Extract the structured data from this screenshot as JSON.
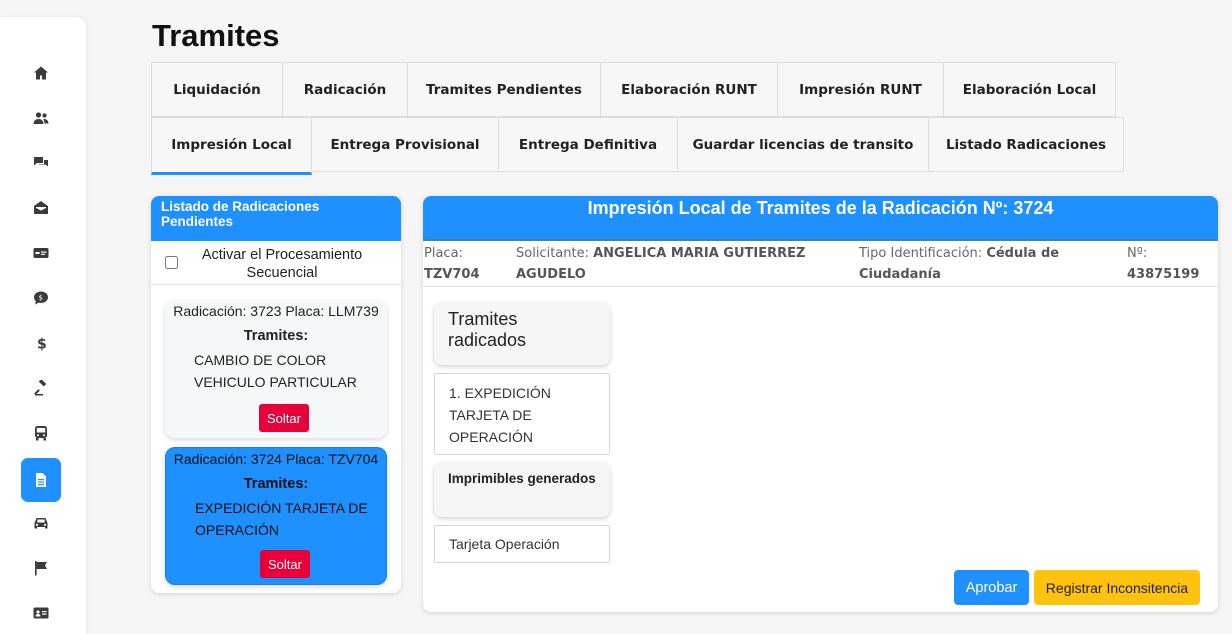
{
  "sidebar": {
    "items": [
      {
        "icon": "home-icon"
      },
      {
        "icon": "users-icon"
      },
      {
        "icon": "comments-icon"
      },
      {
        "icon": "mail-open-icon"
      },
      {
        "icon": "money-card-icon"
      },
      {
        "icon": "comment-dollar-icon"
      },
      {
        "icon": "dollar-icon"
      },
      {
        "icon": "gavel-icon"
      },
      {
        "icon": "bus-icon"
      },
      {
        "icon": "document-icon",
        "active": true
      },
      {
        "icon": "car-icon"
      },
      {
        "icon": "flag-icon"
      },
      {
        "icon": "id-card-icon"
      }
    ],
    "accent_color": "#1e90ff"
  },
  "page": {
    "title": "Tramites"
  },
  "tabs": [
    {
      "label": "Liquidación"
    },
    {
      "label": "Radicación"
    },
    {
      "label": "Tramites Pendientes"
    },
    {
      "label": "Elaboración RUNT"
    },
    {
      "label": "Impresión RUNT"
    },
    {
      "label": "Elaboración Local"
    },
    {
      "label": "Impresión Local",
      "active": true
    },
    {
      "label": "Entrega Provisional"
    },
    {
      "label": "Entrega Definitiva"
    },
    {
      "label": "Guardar licencias de transito"
    },
    {
      "label": "Listado Radicaciones"
    }
  ],
  "left_panel": {
    "title": "Listado de Radicaciones Pendientes",
    "sequential_label": "Activar el Procesamiento Secuencial",
    "sequential_checked": false,
    "cards": [
      {
        "header": "Radicación: 3723 Placa: LLM739",
        "tramites_label": "Tramites:",
        "tramites": "CAMBIO DE COLOR VEHICULO PARTICULAR",
        "button": "Soltar",
        "selected": false
      },
      {
        "header": "Radicación: 3724 Placa: TZV704",
        "tramites_label": "Tramites:",
        "tramites": "EXPEDICIÓN TARJETA DE OPERACIÓN",
        "button": "Soltar",
        "selected": true
      }
    ]
  },
  "right_panel": {
    "title": "Impresión Local de Tramites de la Radicación Nº: 3724",
    "info": {
      "placa_label": "Placa:",
      "placa_value": "TZV704",
      "solicitante_label": "Solicitante:",
      "solicitante_value": "ANGELICA MARIA GUTIERREZ AGUDELO",
      "tipo_id_label": "Tipo Identificación:",
      "tipo_id_value": "Cédula de Ciudadanía",
      "numero_label": "Nº:",
      "numero_value": "43875199"
    },
    "tramites_radicados_title": "Tramites radicados",
    "tramites_radicados": [
      "1. EXPEDICIÓN TARJETA DE OPERACIÓN"
    ],
    "imprimibles_title": "Imprimibles generados",
    "imprimibles": [
      "Tarjeta Operación"
    ],
    "buttons": {
      "aprobar": "Aprobar",
      "registrar": "Registrar Inconsitencia"
    }
  },
  "colors": {
    "primary": "#1e90ff",
    "danger": "#e8003a",
    "warning": "#ffc20e"
  }
}
